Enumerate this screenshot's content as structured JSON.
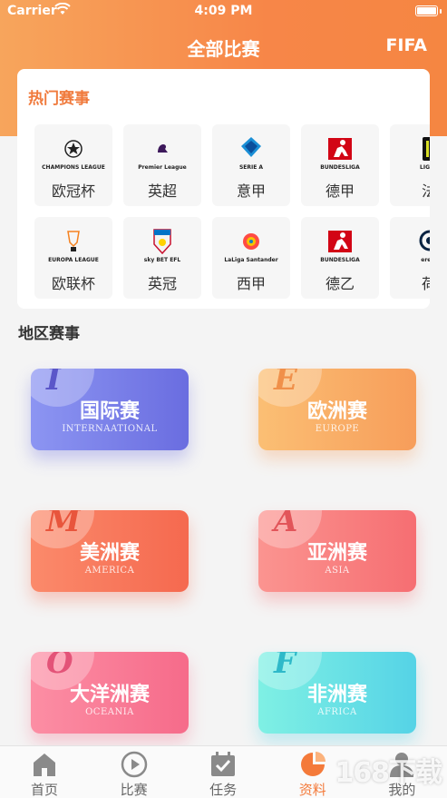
{
  "status_bar": {
    "carrier": "Carrier",
    "time": "4:09 PM"
  },
  "nav": {
    "title": "全部比赛",
    "right": "FIFA"
  },
  "hot": {
    "title": "热门赛事",
    "row1": [
      {
        "name": "欧冠杯",
        "logo": "CHAMPIONS LEAGUE",
        "icon": "champions-league-logo"
      },
      {
        "name": "英超",
        "logo": "Premier League",
        "icon": "premier-league-logo"
      },
      {
        "name": "意甲",
        "logo": "SERIE A",
        "icon": "serie-a-logo"
      },
      {
        "name": "德甲",
        "logo": "BUNDESLIGA",
        "icon": "bundesliga-logo"
      },
      {
        "name": "法",
        "logo": "LIGUE",
        "icon": "ligue1-logo"
      }
    ],
    "row2": [
      {
        "name": "欧联杯",
        "logo": "EUROPA LEAGUE",
        "icon": "europa-league-logo"
      },
      {
        "name": "英冠",
        "logo": "sky BET EFL",
        "icon": "efl-championship-logo"
      },
      {
        "name": "西甲",
        "logo": "LaLiga Santander",
        "icon": "laliga-logo"
      },
      {
        "name": "德乙",
        "logo": "BUNDESLIGA",
        "icon": "bundesliga2-logo"
      },
      {
        "name": "荷",
        "logo": "eredi",
        "icon": "eredivisie-logo"
      }
    ]
  },
  "regions_title": "地区赛事",
  "regions": [
    {
      "letter": "I",
      "cn": "国际赛",
      "en": "INTERNAATIONAL",
      "c1": "#8c95f2",
      "c2": "#6a6de0",
      "lc": "#5b57c9"
    },
    {
      "letter": "E",
      "cn": "欧洲赛",
      "en": "EUROPE",
      "c1": "#fbbf74",
      "c2": "#f79d5a",
      "lc": "#f0904a"
    },
    {
      "letter": "M",
      "cn": "美洲赛",
      "en": "AMERICA",
      "c1": "#fb8a6b",
      "c2": "#f5694f",
      "lc": "#e8553c"
    },
    {
      "letter": "A",
      "cn": "亚洲赛",
      "en": "ASIA",
      "c1": "#fb9490",
      "c2": "#f66e72",
      "lc": "#e2555a"
    },
    {
      "letter": "O",
      "cn": "大洋洲赛",
      "en": "OCEANIA",
      "c1": "#fc8ea4",
      "c2": "#f66b8a",
      "lc": "#e35378"
    },
    {
      "letter": "F",
      "cn": "非洲赛",
      "en": "AFRICA",
      "c1": "#7ff0e4",
      "c2": "#55d3e6",
      "lc": "#2fb9c9"
    }
  ],
  "tabs": [
    {
      "label": "首页",
      "icon": "home-icon"
    },
    {
      "label": "比赛",
      "icon": "play-icon"
    },
    {
      "label": "任务",
      "icon": "calendar-check-icon"
    },
    {
      "label": "资料",
      "icon": "pie-chart-icon",
      "active": true
    },
    {
      "label": "我的",
      "icon": "user-icon"
    }
  ],
  "watermark": "168下载"
}
